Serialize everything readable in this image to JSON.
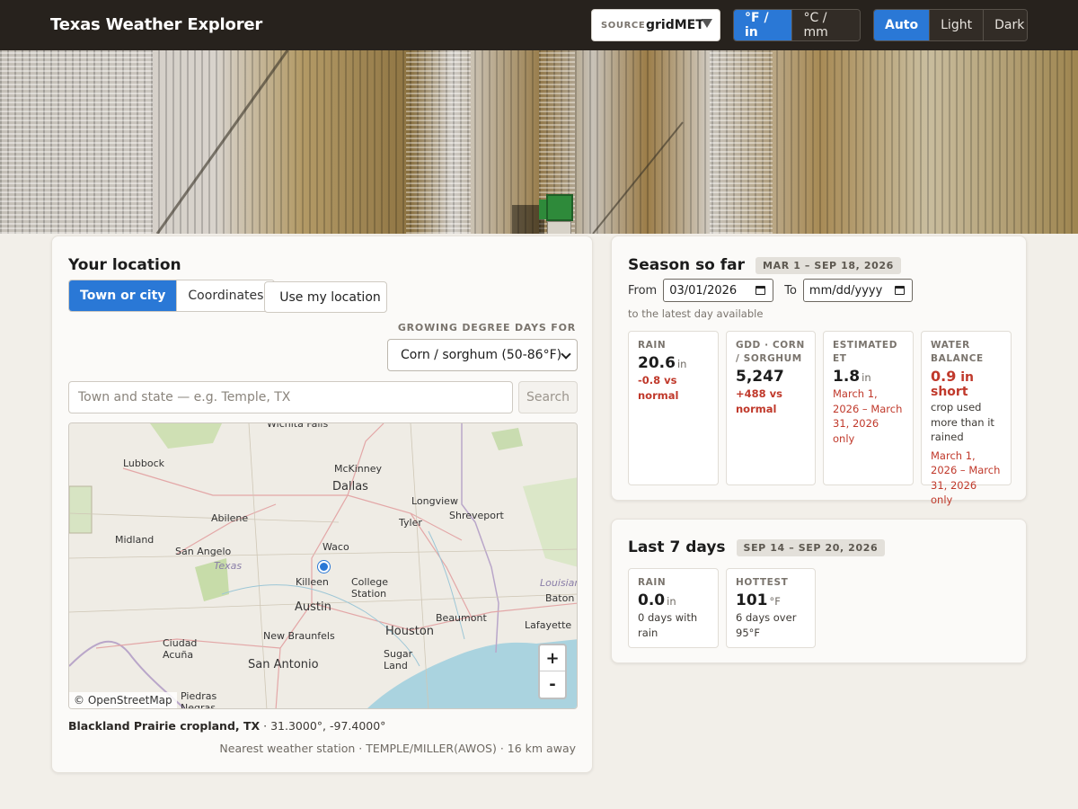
{
  "header": {
    "title": "Texas Weather Explorer",
    "source_label": "SOURCE",
    "source_value": "gridMET",
    "units": [
      "°F / in",
      "°C / mm"
    ],
    "units_active": 0,
    "theme": [
      "Auto",
      "Light",
      "Dark"
    ],
    "theme_active": 0
  },
  "location": {
    "title": "Your location",
    "tabs": [
      "Town or city",
      "Coordinates"
    ],
    "tab_active": 0,
    "use_my_location": "Use my location",
    "gdd_label": "GROWING DEGREE DAYS FOR",
    "gdd_selected": "Corn / sorghum (50-86°F)",
    "search_placeholder": "Town and state — e.g. Temple, TX",
    "search_button": "Search",
    "map_attribution": "© OpenStreetMap",
    "zoom_in": "+",
    "zoom_out": "-",
    "map_labels": {
      "wichita_falls": "Wichita Falls",
      "lubbock": "Lubbock",
      "mckinney": "McKinney",
      "dallas": "Dallas",
      "longview": "Longview",
      "abilene": "Abilene",
      "tyler": "Tyler",
      "shreveport": "Shreveport",
      "midland": "Midland",
      "san_angelo": "San Angelo",
      "waco": "Waco",
      "texas": "Texas",
      "killeen": "Killeen",
      "college_station": "College Station",
      "louisiana": "Louisiana",
      "baton": "Baton",
      "austin": "Austin",
      "beaumont": "Beaumont",
      "lafayette": "Lafayette",
      "new_braunfels": "New Braunfels",
      "houston": "Houston",
      "ciudad_acuna": "Ciudad Acuña",
      "sugar_land": "Sugar Land",
      "san_antonio": "San Antonio",
      "piedras_negras": "Piedras Negras"
    },
    "place_name": "Blackland Prairie cropland, TX",
    "coords": "· 31.3000°, -97.4000°",
    "station": "Nearest weather station · TEMPLE/MILLER(AWOS) · 16 km away"
  },
  "season": {
    "title": "Season so far",
    "range_pill": "MAR 1 – SEP 18, 2026",
    "from_label": "From",
    "from_value": "03/01/2026",
    "to_label": "To",
    "to_value": "mm/dd/yyyy",
    "note": "to the latest day available",
    "stats": [
      {
        "key": "RAIN",
        "value": "20.6",
        "unit": "in",
        "detail": "-0.8 vs normal"
      },
      {
        "key": "GDD · CORN / SORGHUM",
        "value": "5,247",
        "unit": "",
        "detail": "+488 vs normal"
      },
      {
        "key": "ESTIMATED ET",
        "value": "1.8",
        "unit": "in",
        "detail": "March 1, 2026 – March 31, 2026 only"
      },
      {
        "key": "WATER BALANCE",
        "value": "0.9",
        "unit": "in short",
        "detail": "crop used more than it rained",
        "detail2": "March 1, 2026 – March 31, 2026 only"
      }
    ]
  },
  "last7": {
    "title": "Last 7 days",
    "range_pill": "SEP 14 – SEP 20, 2026",
    "stats": [
      {
        "key": "RAIN",
        "value": "0.0",
        "unit": "in",
        "detail": "0 days with rain"
      },
      {
        "key": "HOTTEST",
        "value": "101",
        "unit": "°F",
        "detail": "6 days over 95°F"
      }
    ]
  }
}
